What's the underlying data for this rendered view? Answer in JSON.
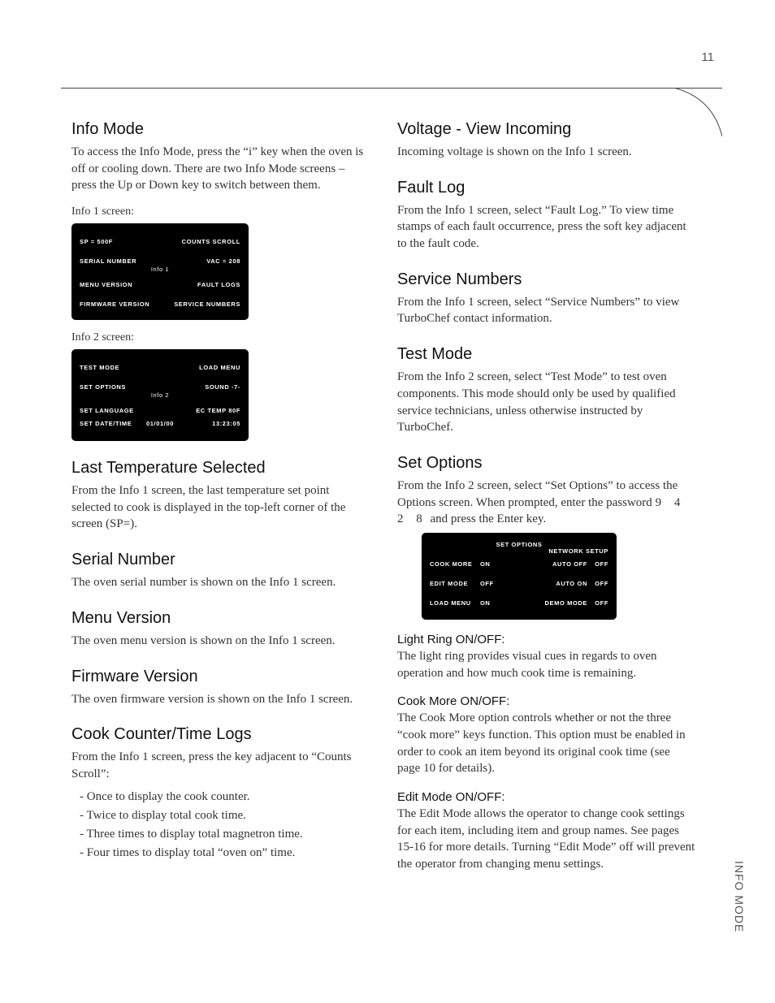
{
  "page_number": "11",
  "sidebar_tab": "INFO MODE",
  "left": {
    "h_infoMode": "Info Mode",
    "p_infoMode": "To access the Info Mode, press the “i” key when the oven is off or cooling down. There are two Info Mode screens – press the Up or Down key to switch between them.",
    "c_info1": "Info 1 screen:",
    "lcd1": {
      "r1l": "SP = 500F",
      "r1r": "COUNTS SCROLL",
      "r2l": "SERIAL NUMBER",
      "r2r": "VAC = 208",
      "tag": "Info 1",
      "r3l": "MENU VERSION",
      "r3r": "FAULT LOGS",
      "r4l": "FIRMWARE VERSION",
      "r4r": "SERVICE NUMBERS"
    },
    "c_info2": "Info 2 screen:",
    "lcd2": {
      "r1l": "TEST MODE",
      "r1r": "LOAD MENU",
      "r2l": "SET OPTIONS",
      "r2r": "SOUND -7-",
      "tag": "Info 2",
      "r3l": "SET LANGUAGE",
      "r3r": "EC TEMP 80F",
      "r4l": "SET DATE/TIME",
      "r4c": "01/01/00",
      "r4r": "13:23:05"
    },
    "h_lastTemp": "Last Temperature Selected",
    "p_lastTemp": "From the Info 1 screen, the last temperature set point selected to cook is displayed in the top-left corner of the screen (SP=).",
    "h_serial": "Serial Number",
    "p_serial": "The oven serial number is shown on the Info 1 screen.",
    "h_menuV": "Menu Version",
    "p_menuV": "The oven menu version is shown on the Info 1 screen.",
    "h_fwV": "Firmware Version",
    "p_fwV": "The oven firmware version is shown on the Info 1 screen.",
    "h_cook": "Cook Counter/Time Logs",
    "p_cook": "From the Info 1 screen, press the key adjacent to “Counts Scroll”:",
    "li1": "Once to display the cook counter.",
    "li2": "Twice to display total cook time.",
    "li3": "Three times to display total magnetron time.",
    "li4": "Four times to display total “oven on” time."
  },
  "right": {
    "h_volt": "Voltage - View Incoming",
    "p_volt": "Incoming voltage is shown on the Info 1 screen.",
    "h_fault": "Fault Log",
    "p_fault": "From the Info 1 screen, select “Fault Log.” To view time stamps of each fault occurrence, press the soft key adjacent to the fault code.",
    "h_svc": "Service Numbers",
    "p_svc": "From the Info 1 screen, select “Service Numbers” to view TurboChef contact information.",
    "h_test": "Test Mode",
    "p_test": "From the Info 2 screen, select “Test Mode” to test oven components. This mode should only be used by qualified service technicians, unless otherwise instructed by TurboChef.",
    "h_setopt": "Set Options",
    "p_setopt_a": "From the Info 2 screen, select “Set Options” to access the Options screen. When prompted, enter the password ",
    "p_setopt_pw": "9 4 2 8",
    "p_setopt_b": " and press the Enter key.",
    "lcd3": {
      "head": "SET OPTIONS",
      "net": "NETWORK SETUP",
      "r1l": "COOK MORE",
      "r1v": "ON",
      "r1r": "AUTO OFF",
      "r1rv": "OFF",
      "r2l": "EDIT MODE",
      "r2v": "OFF",
      "r2r": "AUTO ON",
      "r2rv": "OFF",
      "r3l": "LOAD MENU",
      "r3v": "ON",
      "r3r": "DEMO MODE",
      "r3rv": "OFF"
    },
    "h_light": "Light Ring ON/OFF:",
    "p_light": "The light ring provides visual cues in regards to oven operation and how much cook time is remaining.",
    "h_cookmore": "Cook More ON/OFF:",
    "p_cookmore": "The Cook More option controls whether or not the three “cook more” keys function. This option must be enabled in order to cook an item beyond its original cook time (see page 10 for details).",
    "h_edit": "Edit Mode ON/OFF:",
    "p_edit": "The Edit Mode allows the operator to change cook settings for each item, including item and group names. See pages 15-16 for more details. Turning “Edit Mode” off will prevent the operator from changing menu settings."
  }
}
